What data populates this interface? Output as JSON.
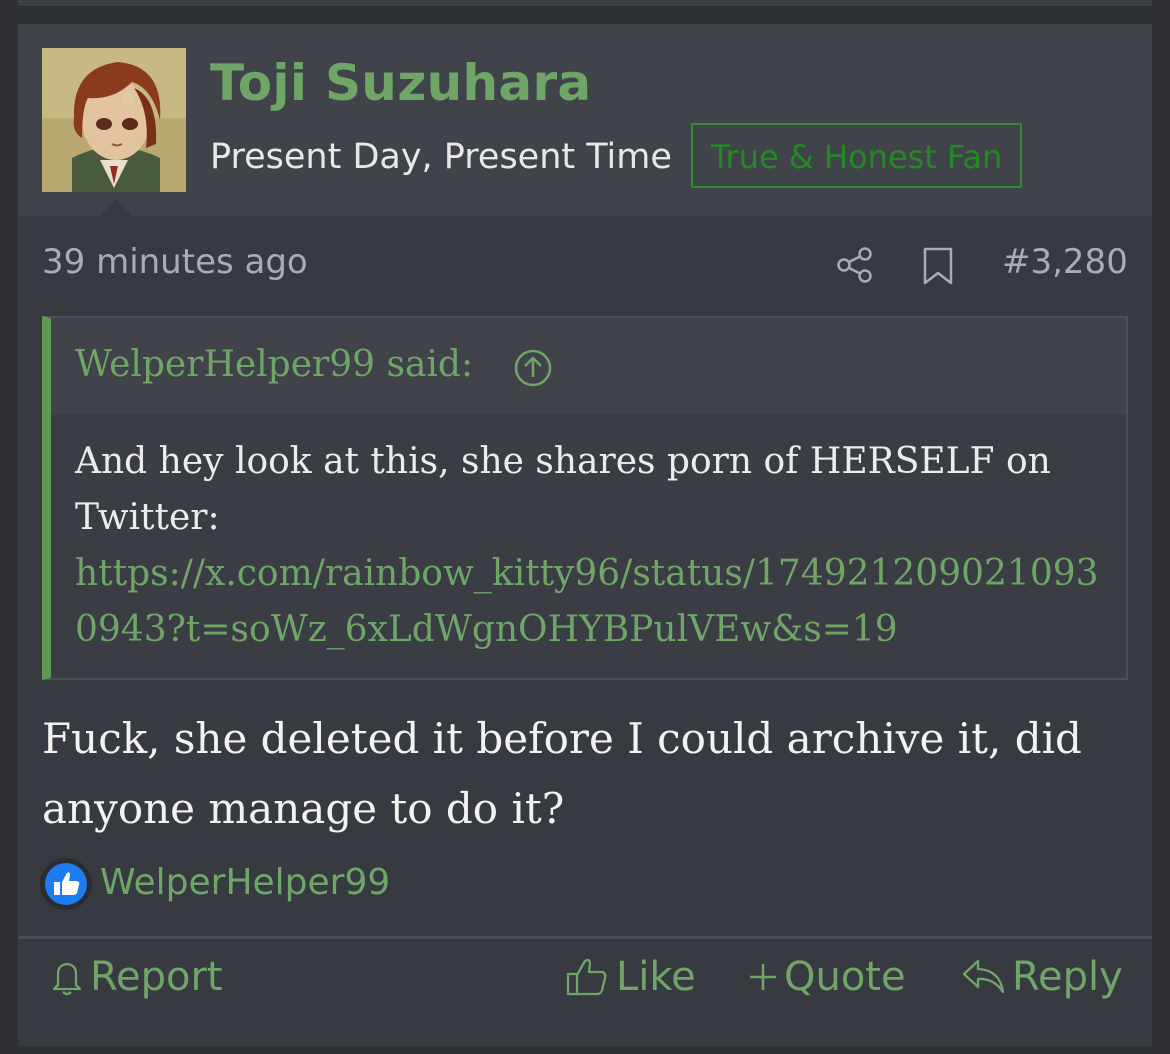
{
  "post": {
    "author": "Toji Suzuhara",
    "user_title": "Present Day, Present Time",
    "user_banner": "True & Honest Fan",
    "time": "39 minutes ago",
    "post_number": "#3,280",
    "quote": {
      "attribution": "WelperHelper99 said:",
      "text": "And hey look at this, she shares porn of HERSELF on Twitter:",
      "link": "https://x.com/rainbow_kitty96/status/1749212090210930943?t=soWz_6xLdWgnOHYBPulVEw&s=19"
    },
    "message": "Fuck, she deleted it before I could archive it, did anyone manage to do it?",
    "reactions": {
      "icon": "like-reaction-icon",
      "users": "WelperHelper99"
    },
    "actions": {
      "report": "Report",
      "like": "Like",
      "quote": "Quote",
      "reply": "Reply"
    }
  },
  "colors": {
    "accent_green": "#6fa566",
    "banner_green": "#238a23",
    "background": "#373a40",
    "header_background": "#40434a",
    "like_blue": "#1d7cf2"
  }
}
